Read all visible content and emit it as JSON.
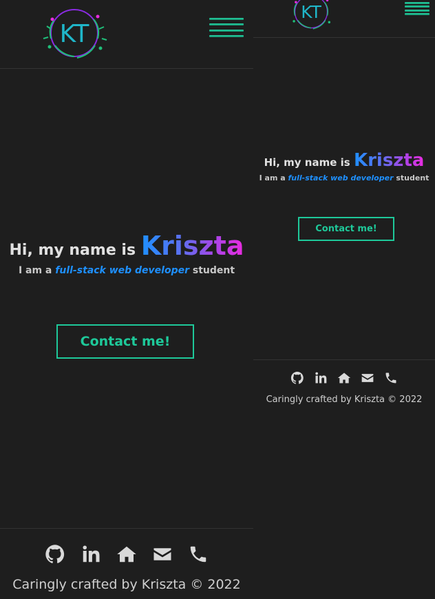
{
  "brand": {
    "logo_text": "KT"
  },
  "hero": {
    "greeting": "Hi, my name is",
    "name": "Kriszta",
    "tagline_prefix": "I am a",
    "role": "full-stack web developer",
    "tagline_suffix": "student"
  },
  "cta": {
    "label": "Contact me!"
  },
  "footer": {
    "icons": [
      "github-icon",
      "linkedin-icon",
      "home-icon",
      "envelope-icon",
      "phone-icon"
    ],
    "credit": "Caringly crafted by Kriszta © 2022"
  },
  "colors": {
    "background": "#1e1e1e",
    "accent": "#1ec99a",
    "role_blue": "#1e90ff",
    "name_gradient": [
      "#1e90ff",
      "#b041e6",
      "#e92be0"
    ]
  }
}
